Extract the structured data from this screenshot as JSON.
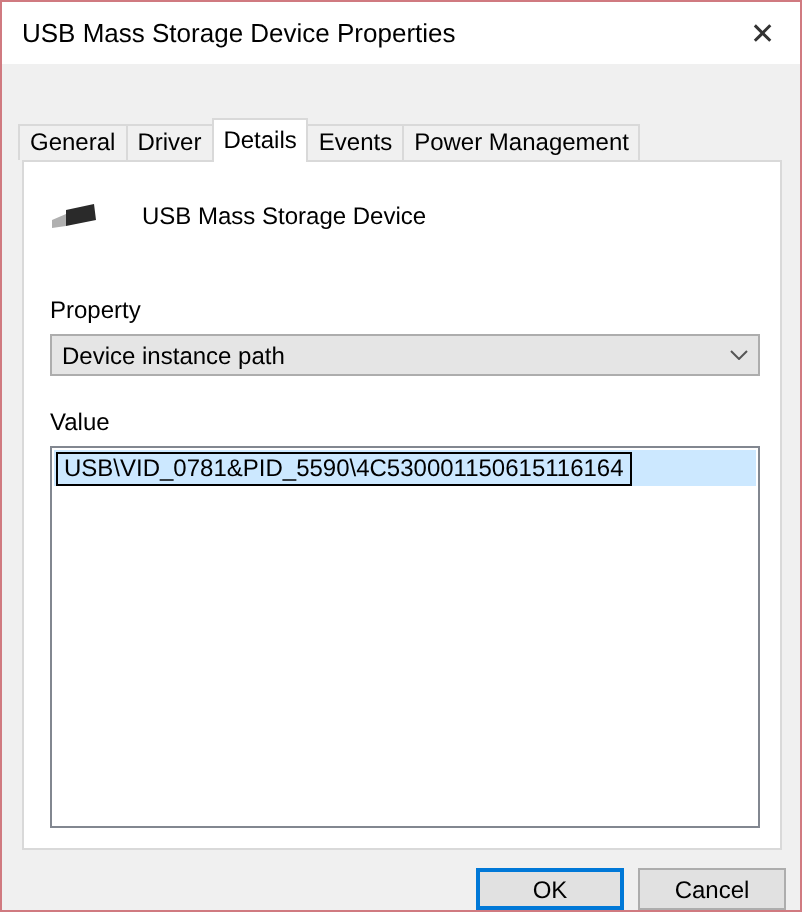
{
  "window": {
    "title": "USB Mass Storage Device Properties",
    "close": "✕"
  },
  "tabs": [
    {
      "label": "General",
      "selected": false
    },
    {
      "label": "Driver",
      "selected": false
    },
    {
      "label": "Details",
      "selected": true
    },
    {
      "label": "Events",
      "selected": false
    },
    {
      "label": "Power Management",
      "selected": false
    }
  ],
  "device": {
    "name": "USB Mass Storage Device"
  },
  "property": {
    "label": "Property",
    "value": "Device instance path"
  },
  "value_list": {
    "label": "Value",
    "items": [
      {
        "text": "USB\\VID_0781&PID_5590\\4C530001150615116164",
        "selected": true
      }
    ]
  },
  "buttons": [
    {
      "label": "OK",
      "kind": "default"
    },
    {
      "label": "Cancel",
      "kind": "normal"
    }
  ]
}
